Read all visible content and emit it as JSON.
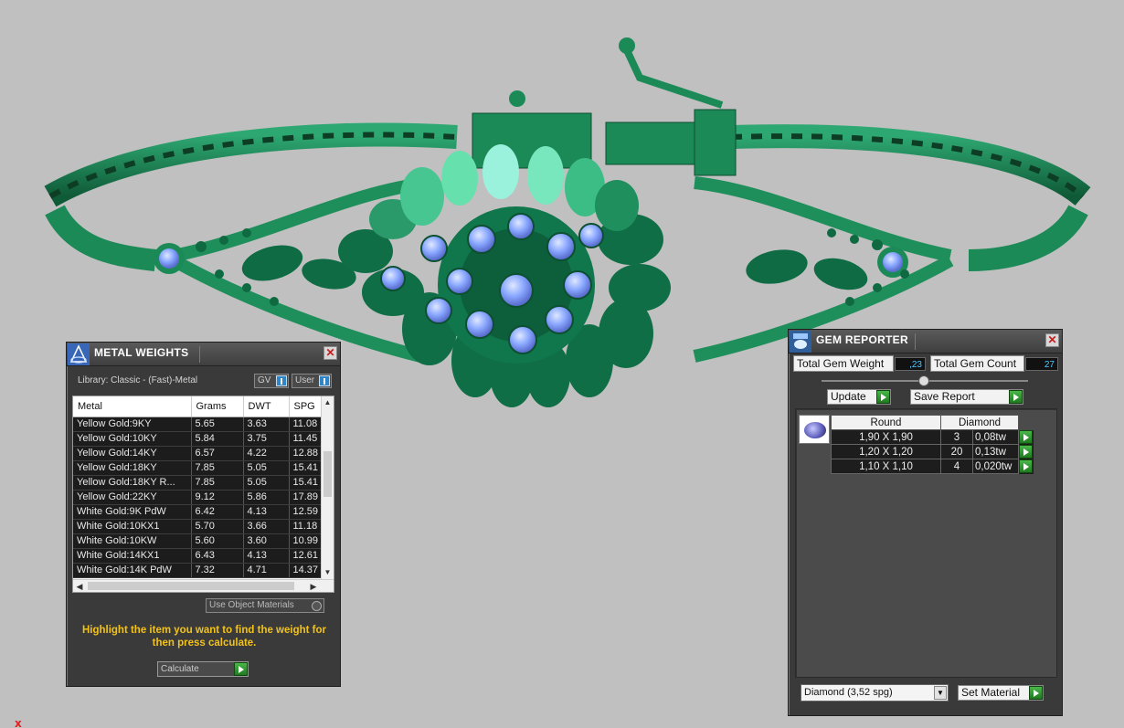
{
  "metal_weights": {
    "title": "METAL WEIGHTS",
    "library": "Library: Classic - (Fast)-Metal",
    "toggle_gv": "GV",
    "toggle_user": "User",
    "columns": [
      "Metal",
      "Grams",
      "DWT",
      "SPG"
    ],
    "rows": [
      [
        "Yellow Gold:9KY",
        "5.65",
        "3.63",
        "11.08"
      ],
      [
        "Yellow Gold:10KY",
        "5.84",
        "3.75",
        "11.45"
      ],
      [
        "Yellow Gold:14KY",
        "6.57",
        "4.22",
        "12.88"
      ],
      [
        "Yellow Gold:18KY",
        "7.85",
        "5.05",
        "15.41"
      ],
      [
        "Yellow Gold:18KY R...",
        "7.85",
        "5.05",
        "15.41"
      ],
      [
        "Yellow Gold:22KY",
        "9.12",
        "5.86",
        "17.89"
      ],
      [
        "White Gold:9K PdW",
        "6.42",
        "4.13",
        "12.59"
      ],
      [
        "White Gold:10KX1",
        "5.70",
        "3.66",
        "11.18"
      ],
      [
        "White Gold:10KW",
        "5.60",
        "3.60",
        "10.99"
      ],
      [
        "White Gold:14KX1",
        "6.43",
        "4.13",
        "12.61"
      ],
      [
        "White Gold:14K PdW",
        "7.32",
        "4.71",
        "14.37"
      ]
    ],
    "use_object_materials": "Use Object Materials",
    "hint": "Highlight the item you want to find the weight for then press calculate.",
    "calculate": "Calculate"
  },
  "gem_reporter": {
    "title": "GEM REPORTER",
    "total_weight_label": "Total Gem Weight",
    "total_weight": ",23",
    "total_count_label": "Total Gem Count",
    "total_count": "27",
    "update": "Update",
    "save_report": "Save Report",
    "shape": "Round",
    "material": "Diamond",
    "rows": [
      [
        "1,90 X 1,90",
        "3",
        "0,08tw"
      ],
      [
        "1,20 X 1,20",
        "20",
        "0,13tw"
      ],
      [
        "1,10 X 1,10",
        "4",
        "0,020tw"
      ]
    ],
    "material_select": "Diamond    (3,52 spg)",
    "set_material": "Set Material"
  },
  "axis_label": "x",
  "colors": {
    "model_green": "#1f8a5a",
    "gem_blue": "#8aa8ff",
    "hint_yellow": "#f2c21b",
    "accent_green": "#2e9e2e"
  }
}
